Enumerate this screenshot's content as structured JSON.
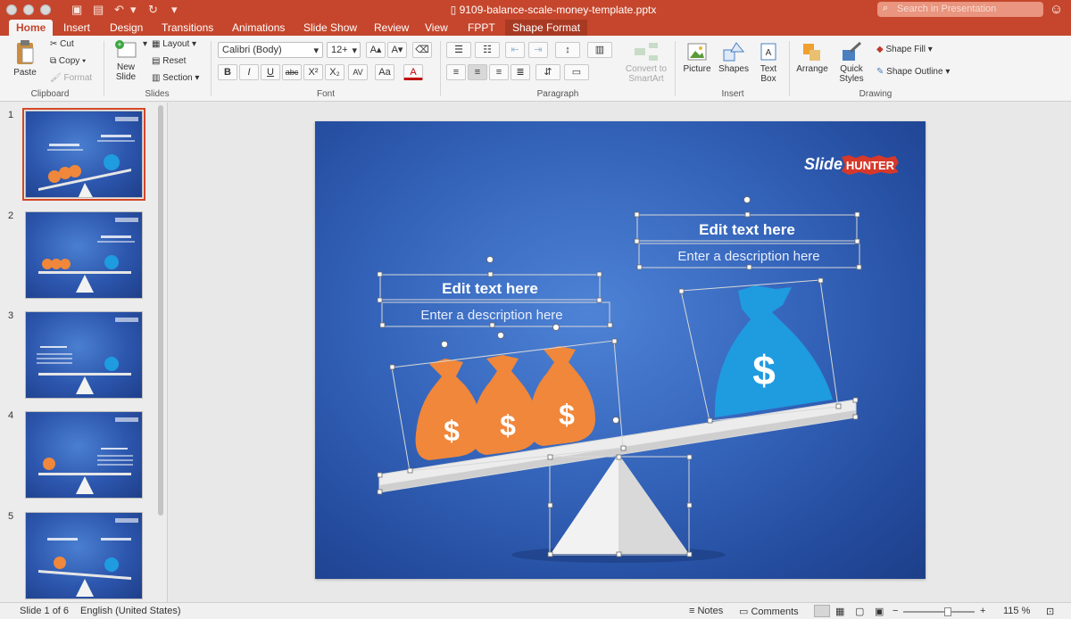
{
  "window": {
    "title": "9109-balance-scale-money-template.pptx",
    "search_placeholder": "Search in Presentation"
  },
  "tabs": [
    "Home",
    "Insert",
    "Design",
    "Transitions",
    "Animations",
    "Slide Show",
    "Review",
    "View",
    "FPPT",
    "Shape Format"
  ],
  "ribbon": {
    "clipboard": {
      "paste": "Paste",
      "cut": "Cut",
      "copy": "Copy",
      "format": "Format",
      "group": "Clipboard"
    },
    "slides": {
      "new_slide_1": "New",
      "new_slide_2": "Slide",
      "layout": "Layout",
      "reset": "Reset",
      "section": "Section",
      "group": "Slides"
    },
    "font": {
      "name": "Calibri (Body)",
      "size": "12+",
      "group": "Font"
    },
    "paragraph": {
      "group": "Paragraph",
      "convert_1": "Convert to",
      "convert_2": "SmartArt"
    },
    "insert": {
      "picture": "Picture",
      "shapes": "Shapes",
      "textbox_1": "Text",
      "textbox_2": "Box",
      "group": "Insert"
    },
    "drawing": {
      "arrange": "Arrange",
      "quick_1": "Quick",
      "quick_2": "Styles",
      "shape_fill": "Shape Fill",
      "shape_outline": "Shape Outline",
      "group": "Drawing"
    }
  },
  "thumbnails": [
    "1",
    "2",
    "3",
    "4",
    "5"
  ],
  "slide": {
    "logo_1": "Slide",
    "logo_2": "HUNTER",
    "left_title": "Edit text here",
    "left_desc": "Enter a description here",
    "right_title": "Edit text here",
    "right_desc": "Enter a description here",
    "dollar": "$"
  },
  "status": {
    "slide_info": "Slide 1 of 6",
    "language": "English (United States)",
    "notes": "Notes",
    "comments": "Comments",
    "zoom": "115 %"
  },
  "colors": {
    "accent": "#c5462c",
    "orange_bag": "#f0873a",
    "blue_bag": "#1f9be0",
    "slide_bg": "#3464ba"
  }
}
